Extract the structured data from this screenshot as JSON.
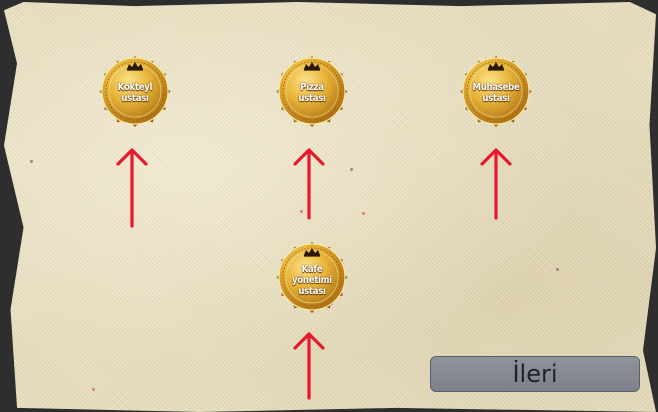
{
  "badges": [
    {
      "id": "kokteyl",
      "line1": "Kokteyl",
      "line2": "ustası",
      "line3": ""
    },
    {
      "id": "pizza",
      "line1": "Pizza",
      "line2": "ustası",
      "line3": ""
    },
    {
      "id": "muhasebe",
      "line1": "Muhasebe",
      "line2": "ustası",
      "line3": ""
    },
    {
      "id": "kafe",
      "line1": "Kafe",
      "line2": "yönetimi",
      "line3": "ustası"
    }
  ],
  "next_button": {
    "label": "İleri"
  },
  "colors": {
    "arrow": "#e8182c",
    "badge_gold_light": "#f7d36a",
    "badge_gold_dark": "#b97a12",
    "button_bg": "#848991"
  },
  "icons": [
    "crown-icon",
    "up-arrow-icon"
  ]
}
